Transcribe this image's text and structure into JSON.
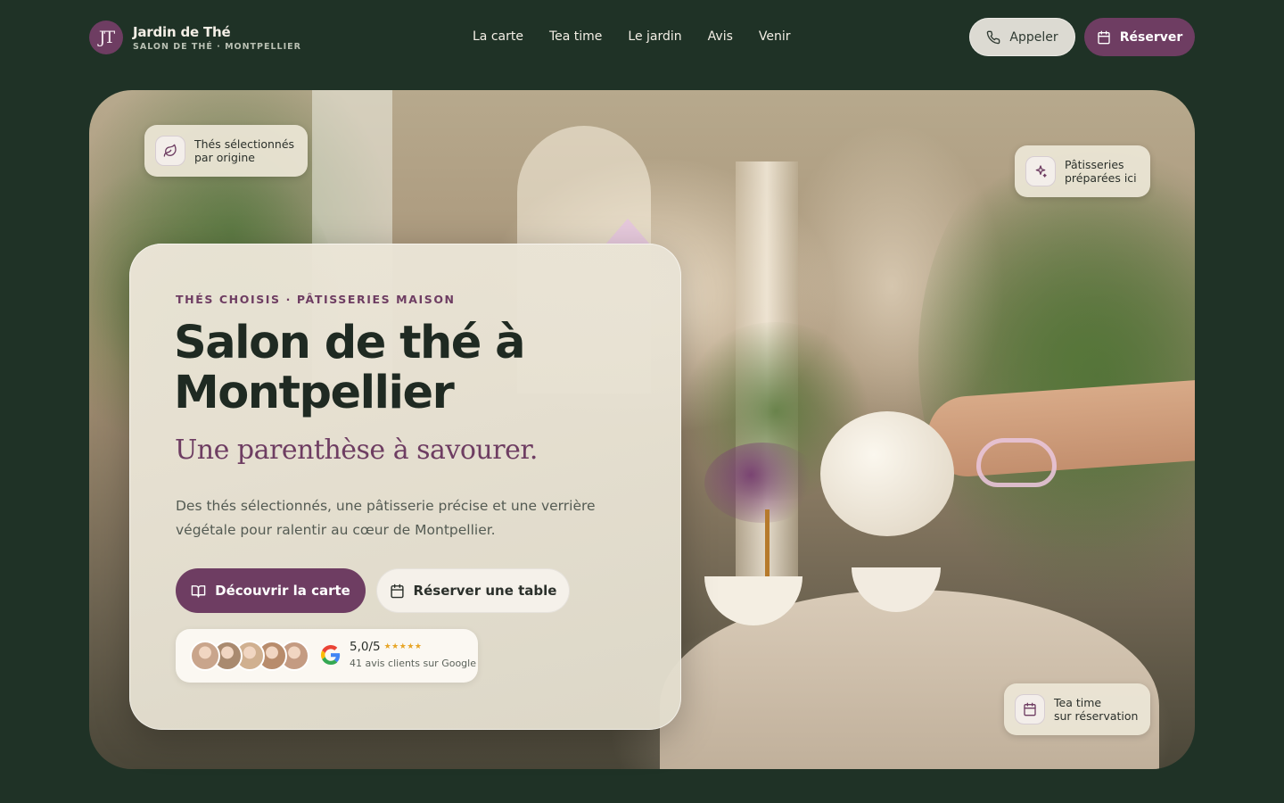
{
  "brand": {
    "monogram": "JT",
    "name": "Jardin de Thé",
    "subtitle": "SALON DE THÉ · MONTPELLIER"
  },
  "nav": {
    "items": [
      "La carte",
      "Tea time",
      "Le jardin",
      "Avis",
      "Venir"
    ]
  },
  "header_actions": {
    "call_label": "Appeler",
    "book_label": "Réserver"
  },
  "badges": {
    "origin": [
      "Thés sélectionnés",
      "par origine"
    ],
    "pastry": [
      "Pâtisseries",
      "préparées ici"
    ],
    "tea_time": [
      "Tea time",
      "sur réservation"
    ]
  },
  "hero": {
    "eyebrow": "THÉS CHOISIS · PÂTISSERIES MAISON",
    "title_line1": "Salon de thé à",
    "title_line2": "Montpellier",
    "tagline": "Une parenthèse à savourer.",
    "description": "Des thés sélectionnés, une pâtisserie précise et une verrière végétale pour ralentir au cœur de Montpellier.",
    "cta_primary": "Découvrir la carte",
    "cta_secondary": "Réserver une table"
  },
  "reviews": {
    "rating": "5,0/5",
    "stars": "★★★★★",
    "count_text": "41 avis clients sur Google",
    "avatar_colors": [
      "#c9a58c",
      "#a98a6f",
      "#d0b090",
      "#b88c6c",
      "#c49b82"
    ]
  },
  "colors": {
    "background": "#1f3226",
    "accent": "#6e3d62",
    "star": "#e7a526"
  },
  "icons": {
    "call": "phone-icon",
    "book": "calendar-icon",
    "menu": "book-open-icon",
    "origin": "leaf-icon",
    "pastry": "sparkle-icon",
    "tea_time": "calendar-icon",
    "google": "google-logo-icon"
  }
}
